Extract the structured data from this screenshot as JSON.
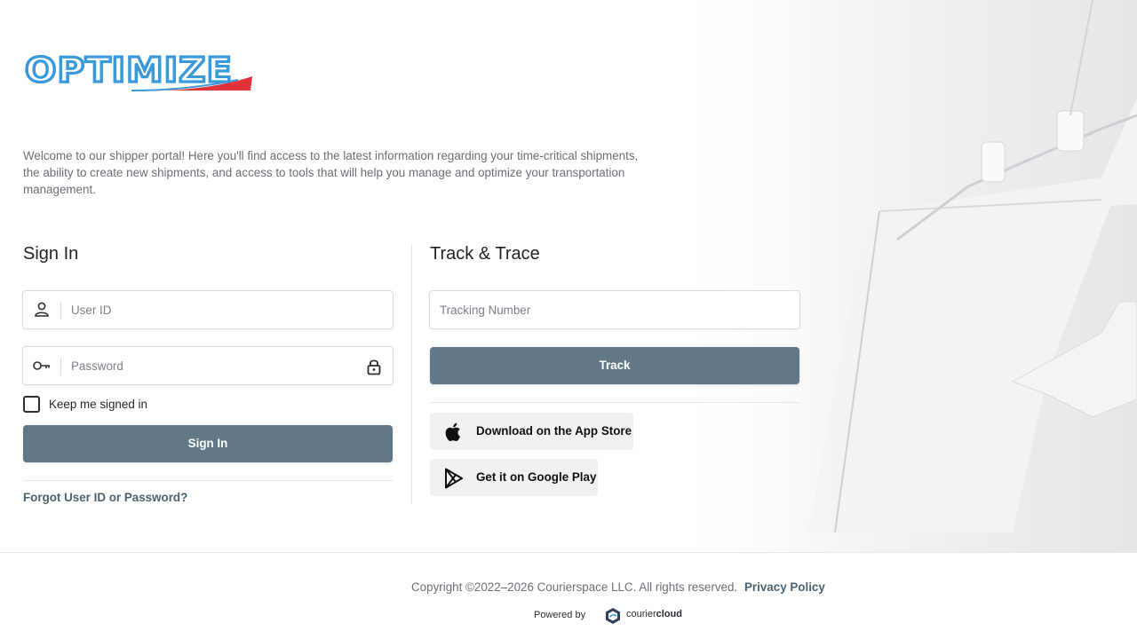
{
  "brand": {
    "logo_text": "OPTIMIZE"
  },
  "intro": "Welcome to our shipper portal! Here you'll find access to the latest information regarding your time-critical shipments, the ability to create new shipments, and access to tools that will help you manage and optimize your transportation management.",
  "sign_in": {
    "title": "Sign In",
    "user_id_placeholder": "User ID",
    "password_placeholder": "Password",
    "keep_signed_in_label": "Keep me signed in",
    "keep_signed_in_checked": false,
    "submit_label": "Sign In",
    "forgot_link": "Forgot User ID or Password?"
  },
  "track": {
    "title": "Track & Trace",
    "tracking_placeholder": "Tracking Number",
    "submit_label": "Track",
    "app_store_label": "Download on the App Store",
    "google_play_label": "Get it on Google Play"
  },
  "footer": {
    "copyright": "Copyright ©2022–2026 Courierspace LLC. All rights reserved.",
    "privacy_link": "Privacy Policy",
    "powered_by": "Powered by",
    "partner_prefix": "courier",
    "partner_suffix": "cloud"
  },
  "colors": {
    "primary_button": "#627887",
    "link": "#4c6170",
    "logo_blue": "#3a9ad9",
    "logo_red": "#e0343a"
  },
  "icons": {
    "user_field": "user-icon",
    "password_field": "key-icon",
    "password_toggle": "lock-icon",
    "app_store": "apple-icon",
    "google_play": "google-play-icon"
  }
}
